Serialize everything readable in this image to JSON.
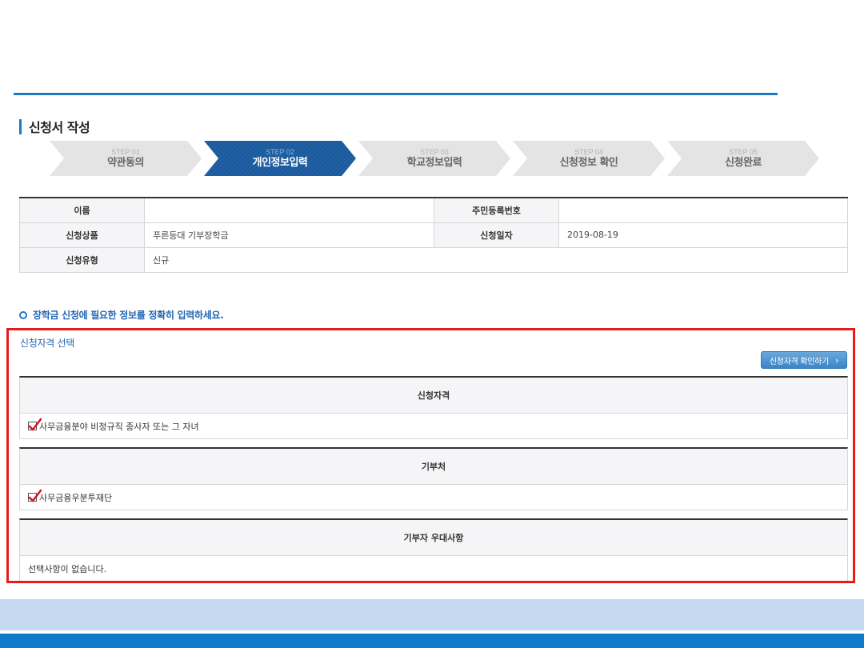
{
  "section": {
    "title": "신청서 작성"
  },
  "steps": [
    {
      "num": "STEP 01",
      "name": "약관동의",
      "active": false
    },
    {
      "num": "STEP 02",
      "name": "개인정보입력",
      "active": true
    },
    {
      "num": "STEP 03",
      "name": "학교정보입력",
      "active": false
    },
    {
      "num": "STEP 04",
      "name": "신청정보 확인",
      "active": false
    },
    {
      "num": "STEP 05",
      "name": "신청완료",
      "active": false
    }
  ],
  "info": {
    "name_label": "이름",
    "name_value": "",
    "rrn_label": "주민등록번호",
    "rrn_value": "",
    "product_label": "신청상품",
    "product_value": "푸른등대 기부장학금",
    "date_label": "신청일자",
    "date_value": "2019-08-19",
    "type_label": "신청유형",
    "type_value": "신규"
  },
  "notice": {
    "text": "장학금 신청에 필요한 정보를 정확히 입력하세요."
  },
  "qualification": {
    "section_label": "신청자격 선택",
    "check_button": "신청자격 확인하기",
    "panels": [
      {
        "header": "신청자격",
        "item": "사무금융분야 비정규직 종사자 또는 그 자녀",
        "checked": true
      },
      {
        "header": "기부처",
        "item": "사무금융우분투재단",
        "checked": true
      },
      {
        "header": "기부자 우대사항",
        "item": "선택사항이 없습니다.",
        "checked": false
      }
    ]
  },
  "colors": {
    "accent": "#1f78c1",
    "active_step": "#1b5a9c",
    "highlight_border": "#e61c1c",
    "footer_light": "#c5d9f0",
    "footer_dark": "#0e7ac9"
  }
}
